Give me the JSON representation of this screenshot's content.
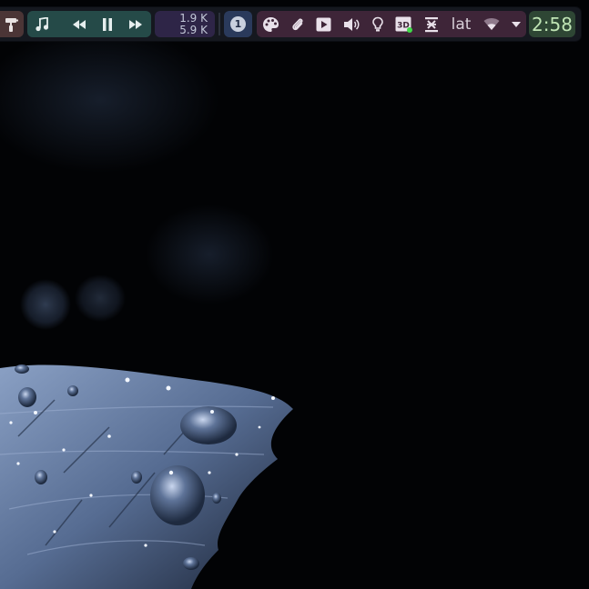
{
  "colors": {
    "bar_background": "#15181f",
    "paint_module": "#4b3536",
    "media_module": "#254a48",
    "network_module": "#2e2547",
    "workspace_module": "#2a3a5b",
    "tray_module": "#3e2538",
    "clock_module": "#2e4634",
    "clock_text": "#bfe4b4",
    "mic_indicator": "#3fdc48"
  },
  "media": {
    "icons": [
      "music-note-icon",
      "rewind-icon",
      "pause-icon",
      "fast-forward-icon"
    ]
  },
  "network": {
    "upload": "1.9 K",
    "download": "5.9 K"
  },
  "workspace": {
    "number": "1"
  },
  "tray": {
    "icons": [
      "palette-icon",
      "paperclip-icon",
      "play-box-icon",
      "volume-icon",
      "lightbulb-icon",
      "3d-icon",
      "keyboard-layout-icon",
      "wifi-icon",
      "dropdown-icon"
    ],
    "keyboard_layout": "lat"
  },
  "clock": {
    "time": "2:58"
  }
}
